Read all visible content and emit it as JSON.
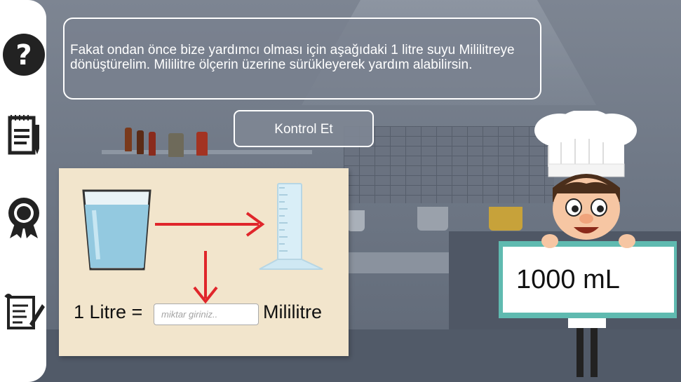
{
  "sidebar": {
    "items": [
      {
        "icon": "help-icon"
      },
      {
        "icon": "notepad-icon"
      },
      {
        "icon": "award-icon"
      },
      {
        "icon": "scroll-icon"
      }
    ]
  },
  "prompt": {
    "text": "Fakat ondan önce bize yardımcı olması için aşağıdaki 1 litre suyu Mililitreye dönüştürelim. Mililitre ölçerin üzerine sürükleyerek yardım alabilirsin."
  },
  "check_button": {
    "label": "Kontrol Et"
  },
  "conversion": {
    "left_label": "1 Litre =",
    "input_placeholder": "miktar giriniz..",
    "input_value": "",
    "unit_label": "Mililitre"
  },
  "measure_card": {
    "value": "1000 mL"
  },
  "colors": {
    "arrow": "#e0262b",
    "board": "#5fbab0",
    "prompt_bg": "#78808e"
  }
}
